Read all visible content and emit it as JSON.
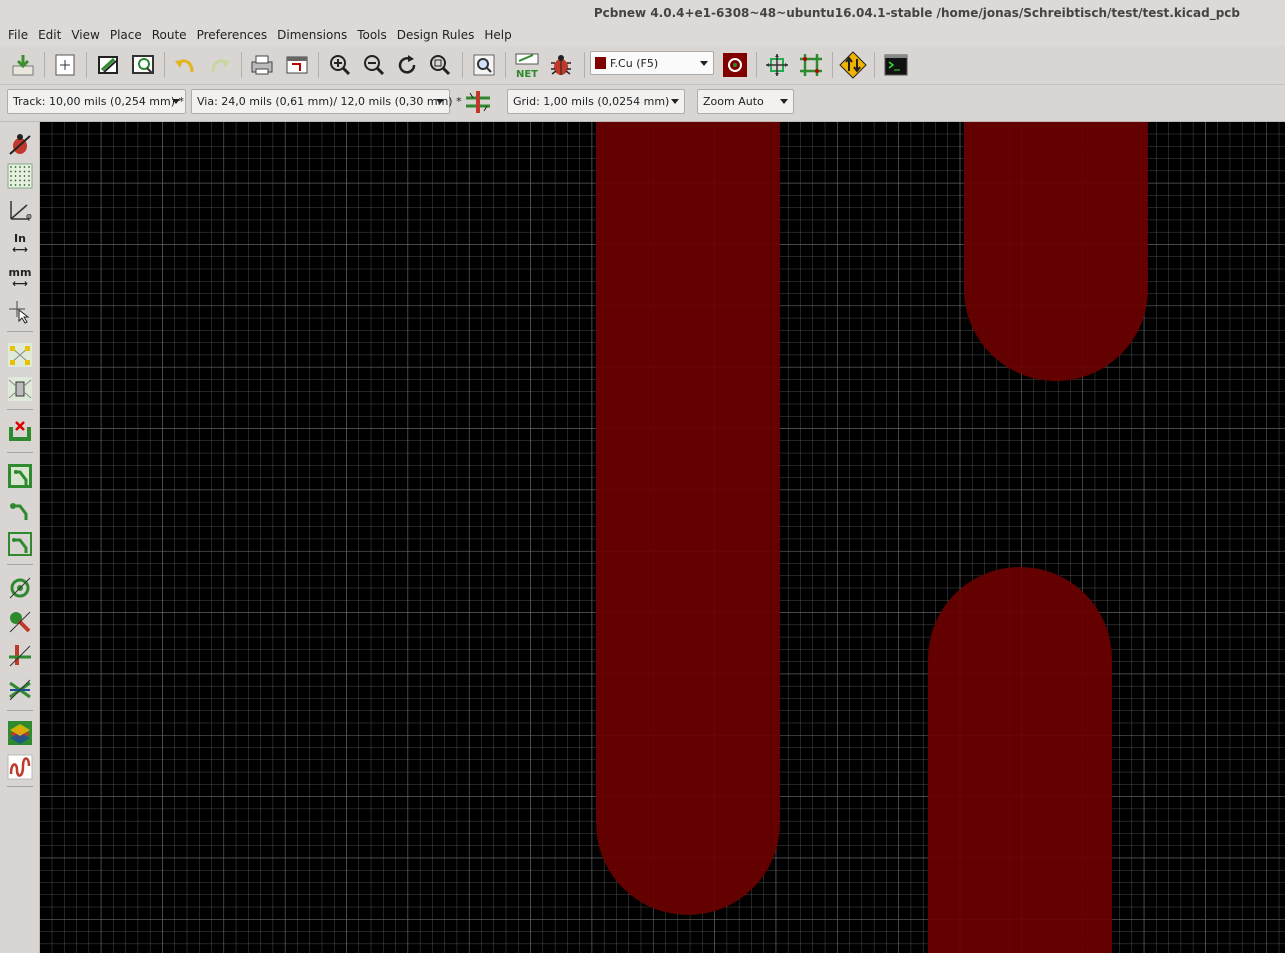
{
  "window": {
    "title": "Pcbnew 4.0.4+e1-6308~48~ubuntu16.04.1-stable /home/jonas/Schreibtisch/test/test.kicad_pcb"
  },
  "menu": [
    "File",
    "Edit",
    "View",
    "Place",
    "Route",
    "Preferences",
    "Dimensions",
    "Tools",
    "Design Rules",
    "Help"
  ],
  "toolbar": {
    "layer_select": {
      "label": "F.Cu (F5)",
      "color": "#800000"
    },
    "icons": [
      "save-board-icon",
      "page-settings-icon",
      "load-module-icon",
      "module-editor-icon",
      "undo-icon",
      "redo-icon",
      "print-icon",
      "plot-icon",
      "zoom-in-icon",
      "zoom-out-icon",
      "redraw-icon",
      "zoom-fit-icon",
      "find-icon",
      "netlist-icon",
      "drc-icon",
      "via-options-icon",
      "autoplace-icon",
      "autoroute-icon",
      "interactive-router-icon",
      "scripting-console-icon"
    ],
    "net_text": "NET"
  },
  "aux_toolbar": {
    "track": "Track: 10,00 mils (0,254 mm) *",
    "via": "Via: 24,0 mils (0,61 mm)/ 12,0 mils (0,30 mm) *",
    "grid": "Grid: 1,00 mils (0,0254 mm)",
    "zoom": "Zoom Auto"
  },
  "left_toolbar": {
    "inch_label": "In",
    "mm_label": "mm",
    "icons": [
      "drc-off-icon",
      "grid-toggle-icon",
      "polar-coords-icon",
      "inch-units-icon",
      "mm-units-icon",
      "cursor-shape-icon",
      "ratsnest-icon",
      "module-ratsnest-icon",
      "auto-delete-track-icon",
      "zone-fill-icon",
      "zone-outline-icon",
      "zone-unfilled-icon",
      "pad-sketch-icon",
      "via-sketch-icon",
      "track-sketch-icon",
      "high-contrast-icon",
      "layers-manager-icon",
      "microwave-icon"
    ]
  },
  "canvas": {
    "background": "#000000",
    "grid_color": "#5a5a5a",
    "copper_color": "#6b0000"
  }
}
